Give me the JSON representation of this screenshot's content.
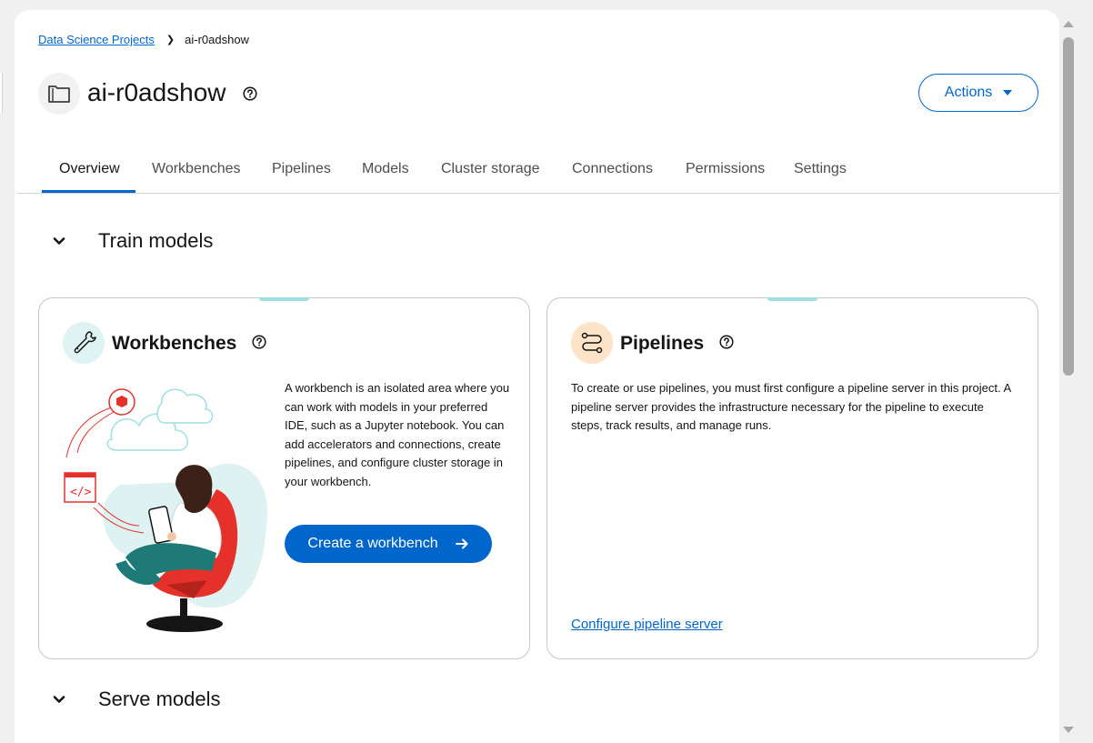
{
  "breadcrumb": {
    "parent": "Data Science Projects",
    "current": "ai-r0adshow"
  },
  "header": {
    "title": "ai-r0adshow",
    "actions_label": "Actions"
  },
  "tabs": [
    {
      "label": "Overview",
      "active": true
    },
    {
      "label": "Workbenches"
    },
    {
      "label": "Pipelines"
    },
    {
      "label": "Models"
    },
    {
      "label": "Cluster storage"
    },
    {
      "label": "Connections"
    },
    {
      "label": "Permissions"
    },
    {
      "label": "Settings"
    }
  ],
  "sections": {
    "train": {
      "label": "Train models"
    },
    "serve": {
      "label": "Serve models"
    }
  },
  "cards": {
    "workbenches": {
      "title": "Workbenches",
      "description": "A workbench is an isolated area where you can work with models in your preferred IDE, such as a Jupyter notebook. You can add accelerators and connections, create pipelines, and configure cluster storage in your workbench.",
      "button_label": "Create a workbench",
      "icon": "wrench-icon"
    },
    "pipelines": {
      "title": "Pipelines",
      "description": "To create or use pipelines, you must first configure a pipeline server in this project. A pipeline server provides the infrastructure necessary for the pipeline to execute steps, track results, and manage runs.",
      "link_label": "Configure pipeline server",
      "icon": "pipeline-icon"
    }
  },
  "colors": {
    "primary": "#0066cc",
    "accent_teal": "#a0dfe3",
    "pipeline_icon_bg": "#fde3c7",
    "workbench_icon_bg": "#e0f3f3"
  }
}
